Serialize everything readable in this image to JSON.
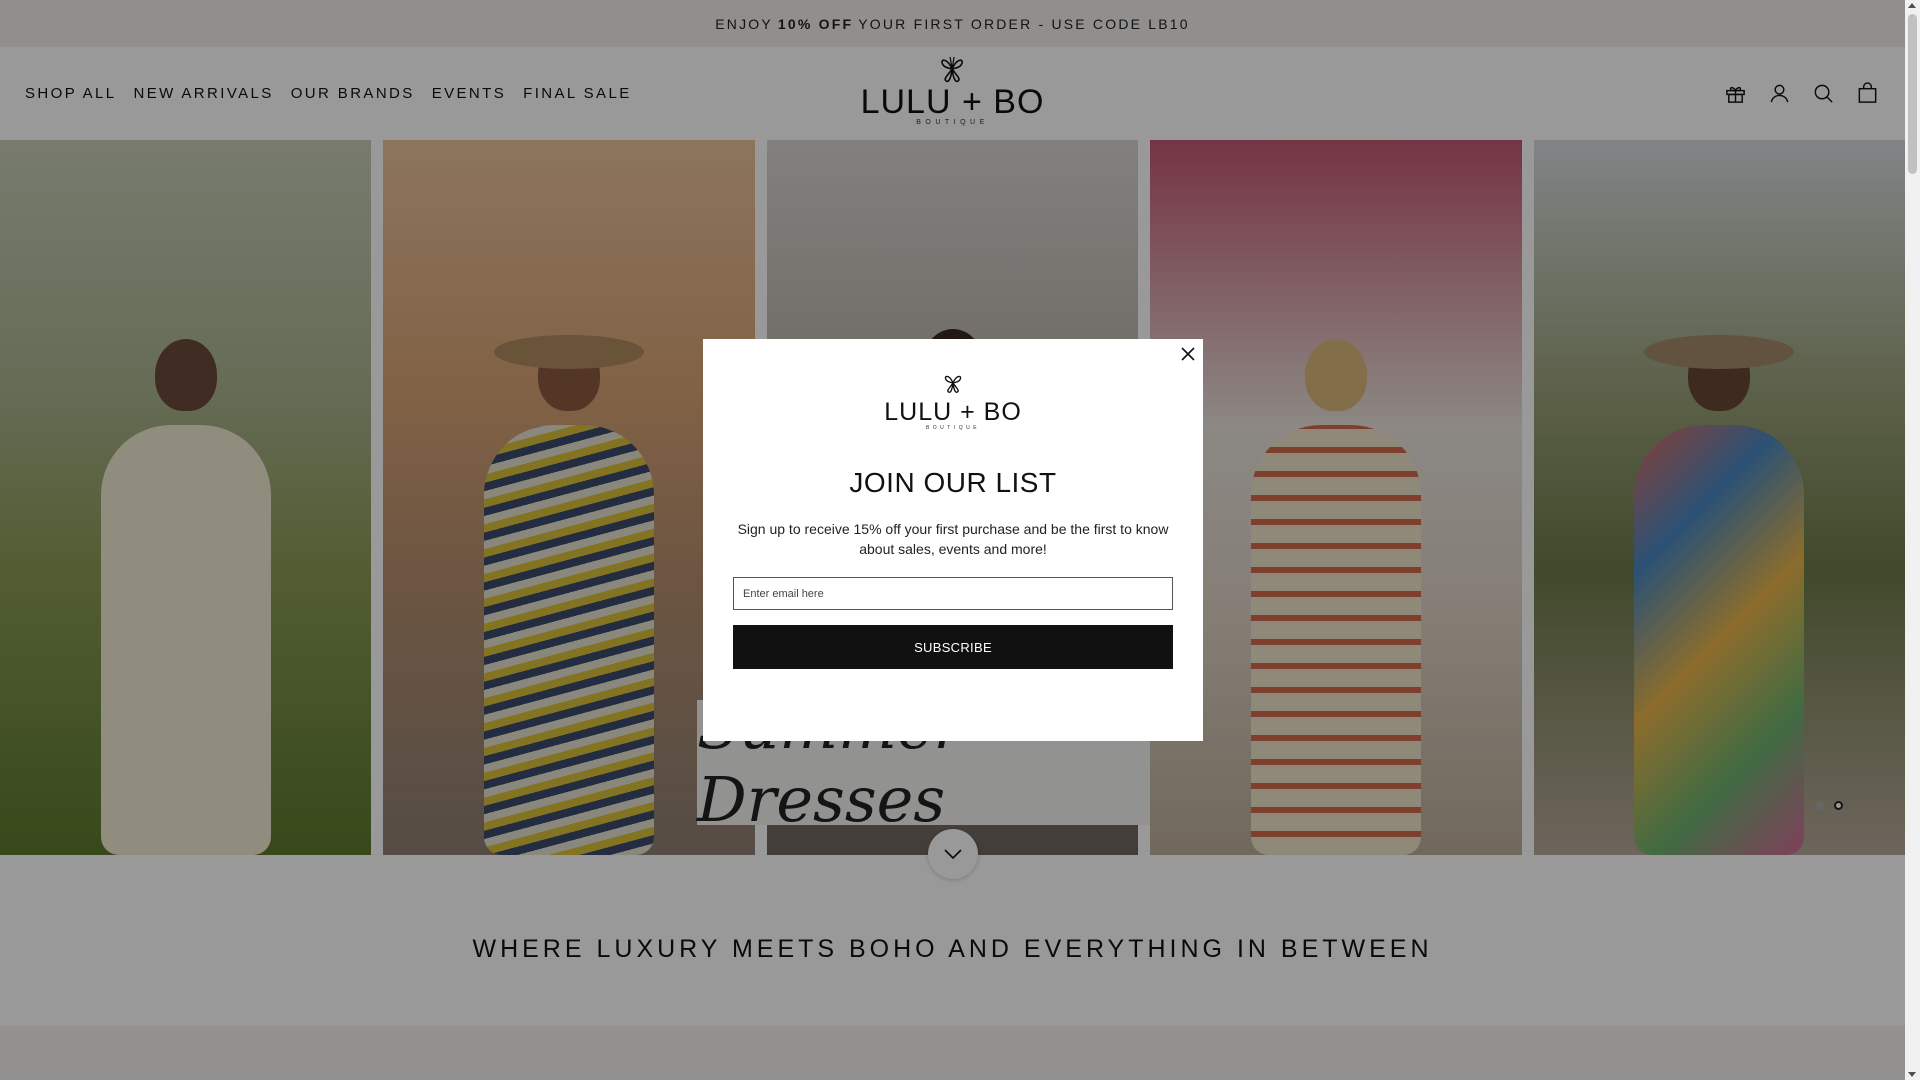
{
  "announcement": {
    "prefix": "ENJOY",
    "bold": "10% OFF",
    "suffix": "YOUR FIRST ORDER - USE CODE LB10"
  },
  "nav": [
    {
      "label": "SHOP ALL"
    },
    {
      "label": "NEW ARRIVALS"
    },
    {
      "label": "OUR BRANDS"
    },
    {
      "label": "EVENTS"
    },
    {
      "label": "FINAL SALE"
    }
  ],
  "logo": {
    "text": "LULU + BO",
    "sub": "BOUTIQUE"
  },
  "header_icons": [
    "gift-icon",
    "account-icon",
    "search-icon",
    "cart-bag-icon"
  ],
  "hero": {
    "overlay_text": "Summer Dresses",
    "slide_count": 2,
    "active_slide": 2
  },
  "tagline": "WHERE LUXURY MEETS BOHO AND EVERYTHING IN BETWEEN",
  "modal": {
    "logo_text": "LULU + BO",
    "logo_sub": "BOUTIQUE",
    "title": "JOIN OUR LIST",
    "body": "Sign up to receive 15% off your first purchase and be the first to know about sales, events and more!",
    "email_placeholder": "Enter email here",
    "button_label": "SUBSCRIBE"
  },
  "colors": {
    "accent": "#111111",
    "announcement_bg": "#f0eeeb",
    "overlay": "rgba(0,0,0,0.4)"
  }
}
